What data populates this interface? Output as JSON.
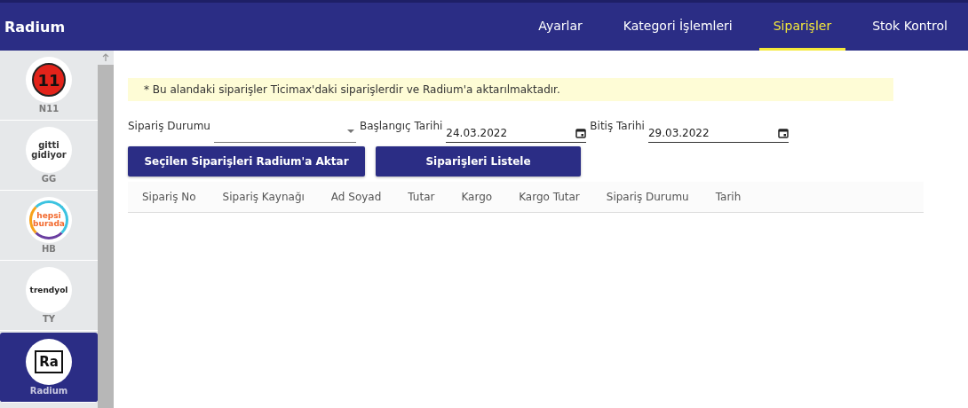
{
  "header": {
    "title": "Radium",
    "nav": [
      {
        "label": "Ayarlar",
        "selected": false
      },
      {
        "label": "Kategori İşlemleri",
        "selected": false
      },
      {
        "label": "Siparişler",
        "selected": true
      },
      {
        "label": "Stok Kontrol",
        "selected": false
      }
    ]
  },
  "sidebar": {
    "items": [
      {
        "kind": "n11",
        "logo_text": "11",
        "label": "N11",
        "selected": false
      },
      {
        "kind": "gg",
        "logo_text": "gitti gidiyor",
        "label": "GG",
        "selected": false
      },
      {
        "kind": "hb",
        "logo_text": "hepsi burada",
        "label": "HB",
        "selected": false
      },
      {
        "kind": "ty",
        "logo_text": "trendyol",
        "label": "TY",
        "selected": false
      },
      {
        "kind": "ra",
        "logo_text": "Ra",
        "label": "Radium",
        "selected": true
      }
    ]
  },
  "notice": "* Bu alandaki siparişler Ticimax'daki siparişlerdir ve Radium'a aktarılmaktadır.",
  "filters": {
    "status_label": "Sipariş Durumu",
    "start_label": "Başlangıç Tarihi",
    "start_value": "24.03.2022",
    "end_label": "Bitiş Tarihi",
    "end_value": "29.03.2022"
  },
  "buttons": [
    "Seçilen Siparişleri Radium'a Aktar",
    "Siparişleri Listele"
  ],
  "table": {
    "columns": [
      "Sipariş No",
      "Sipariş Kaynağı",
      "Ad Soyad",
      "Tutar",
      "Kargo",
      "Kargo Tutar",
      "Sipariş Durumu",
      "Tarih"
    ]
  }
}
